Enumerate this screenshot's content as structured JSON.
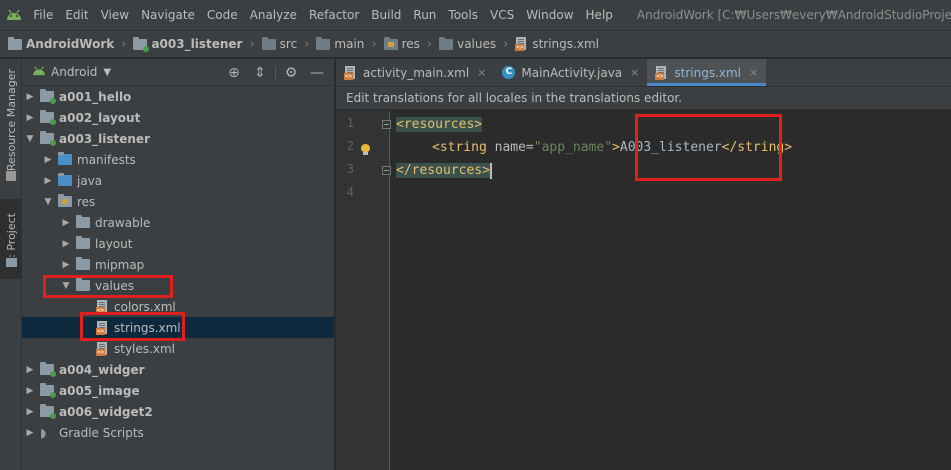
{
  "menubar": {
    "logo_icon": "android-icon",
    "items": [
      "File",
      "Edit",
      "View",
      "Navigate",
      "Code",
      "Analyze",
      "Refactor",
      "Build",
      "Run",
      "Tools",
      "VCS",
      "Window",
      "Help"
    ],
    "window_title": "AndroidWork [C:₩Users₩every₩AndroidStudioProjects₩Home₩"
  },
  "breadcrumb": [
    "AndroidWork",
    "a003_listener",
    "src",
    "main",
    "res",
    "values",
    "strings.xml"
  ],
  "side_tabs": {
    "resource_manager": "Resource Manager",
    "project": "1: Project"
  },
  "project_panel": {
    "view_mode": "Android",
    "tree": [
      {
        "label": "a001_hello",
        "bold": true
      },
      {
        "label": "a002_layout",
        "bold": true
      },
      {
        "label": "a003_listener",
        "bold": true
      },
      {
        "label": "manifests"
      },
      {
        "label": "java"
      },
      {
        "label": "res"
      },
      {
        "label": "drawable"
      },
      {
        "label": "layout"
      },
      {
        "label": "mipmap"
      },
      {
        "label": "values"
      },
      {
        "label": "colors.xml"
      },
      {
        "label": "strings.xml",
        "selected": true
      },
      {
        "label": "styles.xml"
      },
      {
        "label": "a004_widger",
        "bold": true
      },
      {
        "label": "a005_image",
        "bold": true
      },
      {
        "label": "a006_widget2",
        "bold": true
      },
      {
        "label": "Gradle Scripts"
      }
    ]
  },
  "editor": {
    "tabs": [
      {
        "label": "activity_main.xml"
      },
      {
        "label": "MainActivity.java"
      },
      {
        "label": "strings.xml",
        "active": true
      }
    ],
    "close_glyph": "×",
    "notice": "Edit translations for all locales in the translations editor.",
    "line_numbers": [
      "1",
      "2",
      "3",
      "4"
    ],
    "code": {
      "l1": "<resources>",
      "l2_open": "<string",
      "l2_attr": " name=",
      "l2_val": "\"app_name\"",
      "l2_gt": ">",
      "l2_text": "A003_listener",
      "l2_close": "</string>",
      "l3": "</resources>"
    }
  },
  "colors": {
    "highlight_box": "#e0201f",
    "tab_accent": "#4a88c7"
  }
}
